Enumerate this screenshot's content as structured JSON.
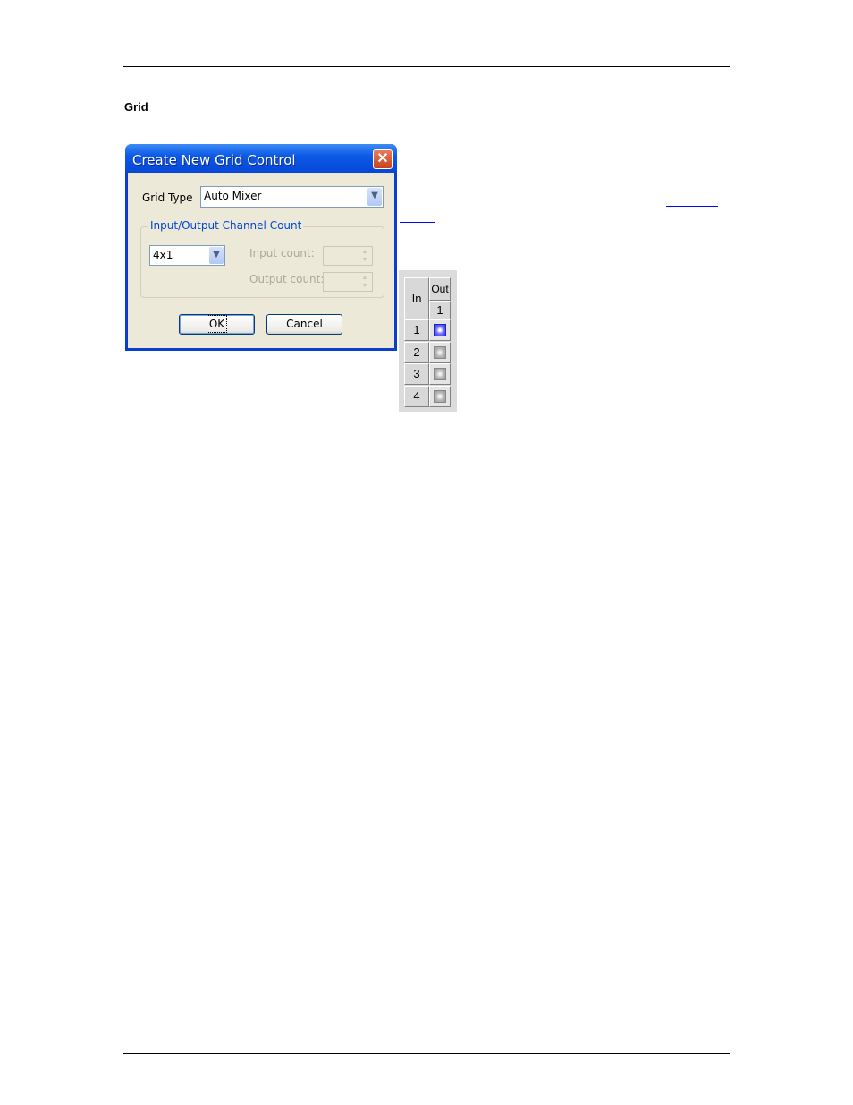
{
  "section_heading": "Grid",
  "dialog": {
    "title": "Create New Grid Control",
    "close_icon": "close-x-icon",
    "grid_type_label": "Grid Type",
    "grid_type_value": "Auto Mixer",
    "group_label": "Input/Output Channel Count",
    "channel_preset_value": "4x1",
    "input_count_label": "Input count:",
    "input_count_value": "",
    "output_count_label": "Output count:",
    "output_count_value": "",
    "ok_label": "OK",
    "cancel_label": "Cancel"
  },
  "grid_preview": {
    "in_header": "In",
    "out_header": "Out",
    "outputs": [
      "1"
    ],
    "inputs": [
      "1",
      "2",
      "3",
      "4"
    ],
    "states": [
      true,
      false,
      false,
      false
    ]
  },
  "colors": {
    "active": "#3030ff",
    "inactive": "#b8b8b8",
    "link": "#0000ff"
  }
}
